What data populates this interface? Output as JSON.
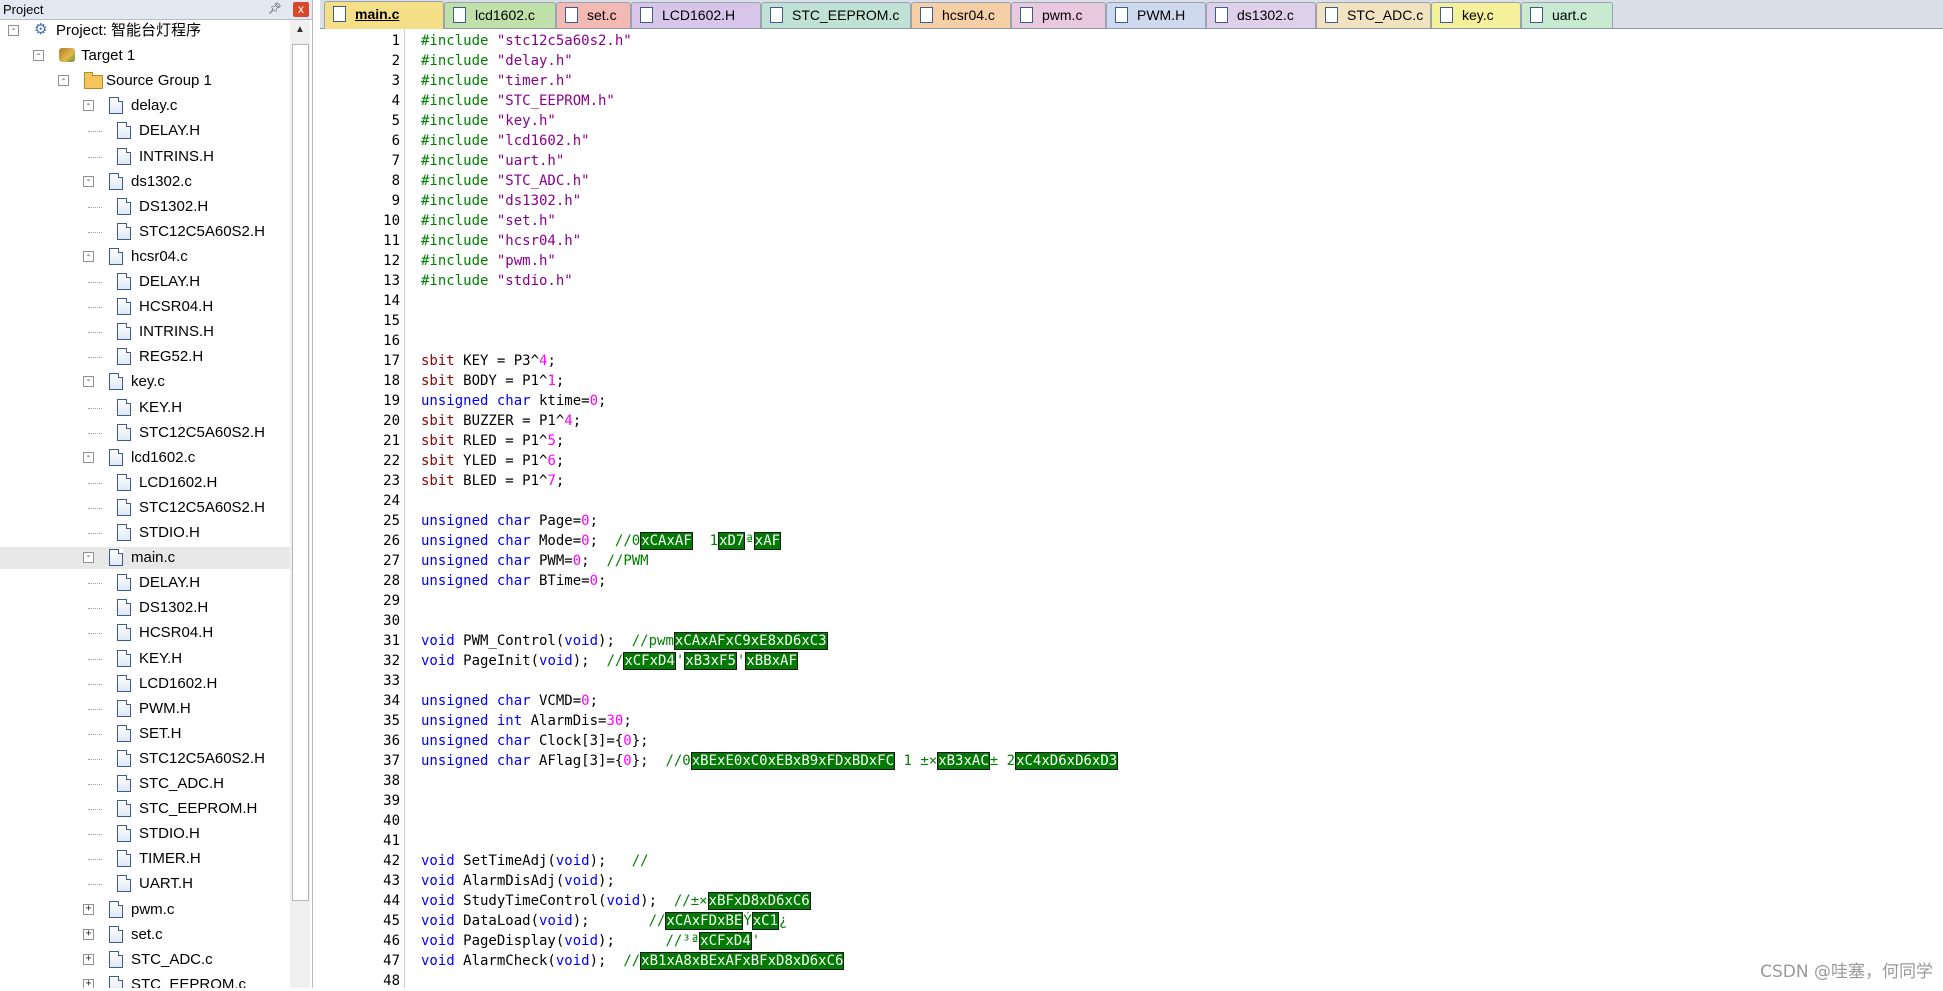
{
  "panel": {
    "title": "Project",
    "pin_icon": "pin-icon",
    "close_label": "x"
  },
  "tree": [
    {
      "label": "Project: 智能台灯程序",
      "icon": "project",
      "depth": 0,
      "expander": "-"
    },
    {
      "label": "Target 1",
      "icon": "target",
      "depth": 1,
      "expander": "-"
    },
    {
      "label": "Source Group 1",
      "icon": "folder",
      "depth": 2,
      "expander": "-"
    },
    {
      "label": "delay.c",
      "icon": "file",
      "depth": 3,
      "expander": "-"
    },
    {
      "label": "DELAY.H",
      "icon": "file",
      "depth": 4
    },
    {
      "label": "INTRINS.H",
      "icon": "file",
      "depth": 4
    },
    {
      "label": "ds1302.c",
      "icon": "file",
      "depth": 3,
      "expander": "-"
    },
    {
      "label": "DS1302.H",
      "icon": "file",
      "depth": 4
    },
    {
      "label": "STC12C5A60S2.H",
      "icon": "file",
      "depth": 4
    },
    {
      "label": "hcsr04.c",
      "icon": "file",
      "depth": 3,
      "expander": "-"
    },
    {
      "label": "DELAY.H",
      "icon": "file",
      "depth": 4
    },
    {
      "label": "HCSR04.H",
      "icon": "file",
      "depth": 4
    },
    {
      "label": "INTRINS.H",
      "icon": "file",
      "depth": 4
    },
    {
      "label": "REG52.H",
      "icon": "file",
      "depth": 4
    },
    {
      "label": "key.c",
      "icon": "file",
      "depth": 3,
      "expander": "-"
    },
    {
      "label": "KEY.H",
      "icon": "file",
      "depth": 4
    },
    {
      "label": "STC12C5A60S2.H",
      "icon": "file",
      "depth": 4
    },
    {
      "label": "lcd1602.c",
      "icon": "file",
      "depth": 3,
      "expander": "-"
    },
    {
      "label": "LCD1602.H",
      "icon": "file",
      "depth": 4
    },
    {
      "label": "STC12C5A60S2.H",
      "icon": "file",
      "depth": 4
    },
    {
      "label": "STDIO.H",
      "icon": "file",
      "depth": 4
    },
    {
      "label": "main.c",
      "icon": "file",
      "depth": 3,
      "expander": "-",
      "selected": true
    },
    {
      "label": "DELAY.H",
      "icon": "file",
      "depth": 4
    },
    {
      "label": "DS1302.H",
      "icon": "file",
      "depth": 4
    },
    {
      "label": "HCSR04.H",
      "icon": "file",
      "depth": 4
    },
    {
      "label": "KEY.H",
      "icon": "file",
      "depth": 4
    },
    {
      "label": "LCD1602.H",
      "icon": "file",
      "depth": 4
    },
    {
      "label": "PWM.H",
      "icon": "file",
      "depth": 4
    },
    {
      "label": "SET.H",
      "icon": "file",
      "depth": 4
    },
    {
      "label": "STC12C5A60S2.H",
      "icon": "file",
      "depth": 4
    },
    {
      "label": "STC_ADC.H",
      "icon": "file",
      "depth": 4
    },
    {
      "label": "STC_EEPROM.H",
      "icon": "file",
      "depth": 4
    },
    {
      "label": "STDIO.H",
      "icon": "file",
      "depth": 4
    },
    {
      "label": "TIMER.H",
      "icon": "file",
      "depth": 4
    },
    {
      "label": "UART.H",
      "icon": "file",
      "depth": 4
    },
    {
      "label": "pwm.c",
      "icon": "file",
      "depth": 3,
      "expander": "+"
    },
    {
      "label": "set.c",
      "icon": "file",
      "depth": 3,
      "expander": "+"
    },
    {
      "label": "STC_ADC.c",
      "icon": "file",
      "depth": 3,
      "expander": "+"
    },
    {
      "label": "STC_EEPROM.c",
      "icon": "file",
      "depth": 3,
      "expander": "+"
    }
  ],
  "tabs": [
    {
      "label": "main.c",
      "color": "#f5df86",
      "active": true
    },
    {
      "label": "lcd1602.c",
      "color": "#bfe0a8"
    },
    {
      "label": "set.c",
      "color": "#f3b9b4"
    },
    {
      "label": "LCD1602.H",
      "color": "#d8c6ea"
    },
    {
      "label": "STC_EEPROM.c",
      "color": "#bfe2d4"
    },
    {
      "label": "hcsr04.c",
      "color": "#f6cfa7"
    },
    {
      "label": "pwm.c",
      "color": "#e9c9df"
    },
    {
      "label": "PWM.H",
      "color": "#cfd9ee"
    },
    {
      "label": "ds1302.c",
      "color": "#ddd0e8"
    },
    {
      "label": "STC_ADC.c",
      "color": "#f1e3bf"
    },
    {
      "label": "key.c",
      "color": "#f5f09a"
    },
    {
      "label": "uart.c",
      "color": "#c7ead0"
    }
  ],
  "code": [
    {
      "n": "1",
      "t": [
        [
          "pp",
          "#include "
        ],
        [
          "str",
          "\"stc12c5a60s2.h\""
        ]
      ]
    },
    {
      "n": "2",
      "t": [
        [
          "pp",
          "#include "
        ],
        [
          "str",
          "\"delay.h\""
        ]
      ]
    },
    {
      "n": "3",
      "t": [
        [
          "pp",
          "#include "
        ],
        [
          "str",
          "\"timer.h\""
        ]
      ]
    },
    {
      "n": "4",
      "t": [
        [
          "pp",
          "#include "
        ],
        [
          "str",
          "\"STC_EEPROM.h\""
        ]
      ]
    },
    {
      "n": "5",
      "t": [
        [
          "pp",
          "#include "
        ],
        [
          "str",
          "\"key.h\""
        ]
      ]
    },
    {
      "n": "6",
      "t": [
        [
          "pp",
          "#include "
        ],
        [
          "str",
          "\"lcd1602.h\""
        ]
      ]
    },
    {
      "n": "7",
      "t": [
        [
          "pp",
          "#include "
        ],
        [
          "str",
          "\"uart.h\""
        ]
      ]
    },
    {
      "n": "8",
      "t": [
        [
          "pp",
          "#include "
        ],
        [
          "str",
          "\"STC_ADC.h\""
        ]
      ]
    },
    {
      "n": "9",
      "t": [
        [
          "pp",
          "#include "
        ],
        [
          "str",
          "\"ds1302.h\""
        ]
      ]
    },
    {
      "n": "10",
      "t": [
        [
          "pp",
          "#include "
        ],
        [
          "str",
          "\"set.h\""
        ]
      ]
    },
    {
      "n": "11",
      "t": [
        [
          "pp",
          "#include "
        ],
        [
          "str",
          "\"hcsr04.h\""
        ]
      ]
    },
    {
      "n": "12",
      "t": [
        [
          "pp",
          "#include "
        ],
        [
          "str",
          "\"pwm.h\""
        ]
      ]
    },
    {
      "n": "13",
      "t": [
        [
          "pp",
          "#include "
        ],
        [
          "str",
          "\"stdio.h\""
        ]
      ]
    },
    {
      "n": "14",
      "t": []
    },
    {
      "n": "15",
      "t": []
    },
    {
      "n": "16",
      "t": []
    },
    {
      "n": "17",
      "t": [
        [
          "sbit",
          "sbit"
        ],
        [
          "plain",
          " KEY = P3^"
        ],
        [
          "num",
          "4"
        ],
        [
          "plain",
          ";"
        ]
      ]
    },
    {
      "n": "18",
      "t": [
        [
          "sbit",
          "sbit"
        ],
        [
          "plain",
          " BODY = P1^"
        ],
        [
          "num",
          "1"
        ],
        [
          "plain",
          ";"
        ]
      ]
    },
    {
      "n": "19",
      "t": [
        [
          "kw",
          "unsigned char"
        ],
        [
          "plain",
          " ktime="
        ],
        [
          "num",
          "0"
        ],
        [
          "plain",
          ";"
        ]
      ]
    },
    {
      "n": "20",
      "t": [
        [
          "sbit",
          "sbit"
        ],
        [
          "plain",
          " BUZZER = P1^"
        ],
        [
          "num",
          "4"
        ],
        [
          "plain",
          ";"
        ]
      ]
    },
    {
      "n": "21",
      "t": [
        [
          "sbit",
          "sbit"
        ],
        [
          "plain",
          " RLED = P1^"
        ],
        [
          "num",
          "5"
        ],
        [
          "plain",
          ";"
        ]
      ]
    },
    {
      "n": "22",
      "t": [
        [
          "sbit",
          "sbit"
        ],
        [
          "plain",
          " YLED = P1^"
        ],
        [
          "num",
          "6"
        ],
        [
          "plain",
          ";"
        ]
      ]
    },
    {
      "n": "23",
      "t": [
        [
          "sbit",
          "sbit"
        ],
        [
          "plain",
          " BLED = P1^"
        ],
        [
          "num",
          "7"
        ],
        [
          "plain",
          ";"
        ]
      ]
    },
    {
      "n": "24",
      "t": []
    },
    {
      "n": "25",
      "t": [
        [
          "kw",
          "unsigned char"
        ],
        [
          "plain",
          " Page="
        ],
        [
          "num",
          "0"
        ],
        [
          "plain",
          ";"
        ]
      ]
    },
    {
      "n": "26",
      "t": [
        [
          "kw",
          "unsigned char"
        ],
        [
          "plain",
          " Mode="
        ],
        [
          "num",
          "0"
        ],
        [
          "plain",
          ";  "
        ],
        [
          "cm",
          "//0"
        ],
        [
          "garble",
          "xCAxAF"
        ],
        [
          "cm",
          "  1"
        ],
        [
          "garble",
          "xD7"
        ],
        [
          "cm",
          "ª"
        ],
        [
          "garble",
          "xAF"
        ]
      ]
    },
    {
      "n": "27",
      "t": [
        [
          "kw",
          "unsigned char"
        ],
        [
          "plain",
          " PWM="
        ],
        [
          "num",
          "0"
        ],
        [
          "plain",
          ";  "
        ],
        [
          "cm",
          "//PWM"
        ]
      ]
    },
    {
      "n": "28",
      "t": [
        [
          "kw",
          "unsigned char"
        ],
        [
          "plain",
          " BTime="
        ],
        [
          "num",
          "0"
        ],
        [
          "plain",
          ";"
        ]
      ]
    },
    {
      "n": "29",
      "t": []
    },
    {
      "n": "30",
      "t": []
    },
    {
      "n": "31",
      "t": [
        [
          "kw",
          "void"
        ],
        [
          "plain",
          " PWM_Control("
        ],
        [
          "kw",
          "void"
        ],
        [
          "plain",
          ");  "
        ],
        [
          "cm",
          "//pwm"
        ],
        [
          "garble",
          "xCAxAFxC9xE8xD6xC3"
        ]
      ]
    },
    {
      "n": "32",
      "t": [
        [
          "kw",
          "void"
        ],
        [
          "plain",
          " PageInit("
        ],
        [
          "kw",
          "void"
        ],
        [
          "plain",
          ");  "
        ],
        [
          "cm",
          "//"
        ],
        [
          "garble",
          "xCFxD4"
        ],
        [
          "cm",
          "'"
        ],
        [
          "garble",
          "xB3xF5"
        ],
        [
          "cm",
          "'"
        ],
        [
          "garble",
          "xBBxAF"
        ]
      ]
    },
    {
      "n": "33",
      "t": []
    },
    {
      "n": "34",
      "t": [
        [
          "kw",
          "unsigned char"
        ],
        [
          "plain",
          " VCMD="
        ],
        [
          "num",
          "0"
        ],
        [
          "plain",
          ";"
        ]
      ]
    },
    {
      "n": "35",
      "t": [
        [
          "kw",
          "unsigned int"
        ],
        [
          "plain",
          " AlarmDis="
        ],
        [
          "num",
          "30"
        ],
        [
          "plain",
          ";"
        ]
      ]
    },
    {
      "n": "36",
      "t": [
        [
          "kw",
          "unsigned char"
        ],
        [
          "plain",
          " Clock[3]={"
        ],
        [
          "num",
          "0"
        ],
        [
          "plain",
          "};"
        ]
      ]
    },
    {
      "n": "37",
      "t": [
        [
          "kw",
          "unsigned char"
        ],
        [
          "plain",
          " AFlag[3]={"
        ],
        [
          "num",
          "0"
        ],
        [
          "plain",
          "};  "
        ],
        [
          "cm",
          "//0"
        ],
        [
          "garble",
          "xBExE0xC0xEBxB9xFDxBDxFC"
        ],
        [
          "cm",
          " 1 ±×"
        ],
        [
          "garble",
          "xB3xAC"
        ],
        [
          "cm",
          "± 2"
        ],
        [
          "garble",
          "xC4xD6xD6xD3"
        ]
      ]
    },
    {
      "n": "38",
      "t": []
    },
    {
      "n": "39",
      "t": []
    },
    {
      "n": "40",
      "t": []
    },
    {
      "n": "41",
      "t": []
    },
    {
      "n": "42",
      "t": [
        [
          "kw",
          "void"
        ],
        [
          "plain",
          " SetTimeAdj("
        ],
        [
          "kw",
          "void"
        ],
        [
          "plain",
          ");   "
        ],
        [
          "cm",
          "//"
        ]
      ]
    },
    {
      "n": "43",
      "t": [
        [
          "kw",
          "void"
        ],
        [
          "plain",
          " AlarmDisAdj("
        ],
        [
          "kw",
          "void"
        ],
        [
          "plain",
          ");"
        ]
      ]
    },
    {
      "n": "44",
      "t": [
        [
          "kw",
          "void"
        ],
        [
          "plain",
          " StudyTimeControl("
        ],
        [
          "kw",
          "void"
        ],
        [
          "plain",
          ");  "
        ],
        [
          "cm",
          "//±×"
        ],
        [
          "garble",
          "xBFxD8xD6xC6"
        ]
      ]
    },
    {
      "n": "45",
      "t": [
        [
          "kw",
          "void"
        ],
        [
          "plain",
          " DataLoad("
        ],
        [
          "kw",
          "void"
        ],
        [
          "plain",
          ");       "
        ],
        [
          "cm",
          "//"
        ],
        [
          "garble",
          "xCAxFDxBE"
        ],
        [
          "cm",
          "Ý"
        ],
        [
          "garble",
          "xC1"
        ],
        [
          "cm",
          "¿"
        ]
      ]
    },
    {
      "n": "46",
      "t": [
        [
          "kw",
          "void"
        ],
        [
          "plain",
          " PageDisplay("
        ],
        [
          "kw",
          "void"
        ],
        [
          "plain",
          ");      "
        ],
        [
          "cm",
          "//³ª"
        ],
        [
          "garble",
          "xCFxD4"
        ],
        [
          "cm",
          "'"
        ]
      ]
    },
    {
      "n": "47",
      "t": [
        [
          "kw",
          "void"
        ],
        [
          "plain",
          " AlarmCheck("
        ],
        [
          "kw",
          "void"
        ],
        [
          "plain",
          ");  "
        ],
        [
          "cm",
          "//"
        ],
        [
          "garble",
          "xB1xA8xBExAFxBFxD8xD6xC6"
        ]
      ]
    },
    {
      "n": "48",
      "t": []
    }
  ],
  "watermark": "CSDN @哇塞，何同学"
}
